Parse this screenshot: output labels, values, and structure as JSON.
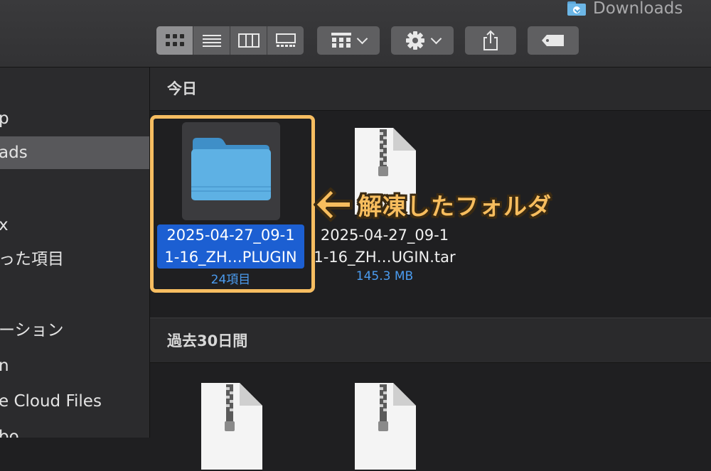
{
  "window": {
    "title": "Downloads",
    "title_icon": "downloads-folder-icon"
  },
  "toolbar": {
    "view_modes": [
      {
        "name": "icon-view",
        "icon": "grid-icon",
        "active": true
      },
      {
        "name": "list-view",
        "icon": "list-icon",
        "active": false
      },
      {
        "name": "column-view",
        "icon": "columns-icon",
        "active": false
      },
      {
        "name": "gallery-view",
        "icon": "gallery-icon",
        "active": false
      }
    ],
    "group_button": {
      "icon": "group-grid-icon",
      "dropdown": "chevron-down-icon"
    },
    "action_button": {
      "icon": "gear-icon",
      "dropdown": "chevron-down-icon"
    },
    "share_button": {
      "icon": "share-icon"
    },
    "tag_button": {
      "icon": "tag-icon"
    }
  },
  "sidebar": {
    "items": [
      {
        "label": "p",
        "selected": false
      },
      {
        "label": "ads",
        "selected": true
      },
      {
        "label": "x",
        "selected": false
      },
      {
        "label": "った項目",
        "selected": false
      },
      {
        "label": "ーション",
        "selected": false
      },
      {
        "label": "n",
        "selected": false
      },
      {
        "label": "e Cloud Files",
        "selected": false
      },
      {
        "label": "bo",
        "selected": false
      }
    ]
  },
  "sections": [
    {
      "label": "今日",
      "items": [
        {
          "line1": "2025-04-27_09-1",
          "line2": "1-16_ZH…PLUGIN",
          "meta": "24項目",
          "kind": "folder",
          "selected": true
        },
        {
          "line1": "2025-04-27_09-1",
          "line2": "1-16_ZH…UGIN.tar",
          "meta": "145.3 MB",
          "kind": "archive",
          "selected": false
        }
      ]
    },
    {
      "label": "過去30日間",
      "items": [
        {
          "kind": "archive"
        },
        {
          "kind": "archive"
        }
      ]
    }
  ],
  "annotation": {
    "text": "解凍したフォルダ",
    "icon": "arrow-left-icon",
    "color": "#f7bd5e"
  },
  "colors": {
    "selection": "#1c5fd2",
    "meta": "#4b9cf0",
    "highlight": "#f6bd61"
  }
}
